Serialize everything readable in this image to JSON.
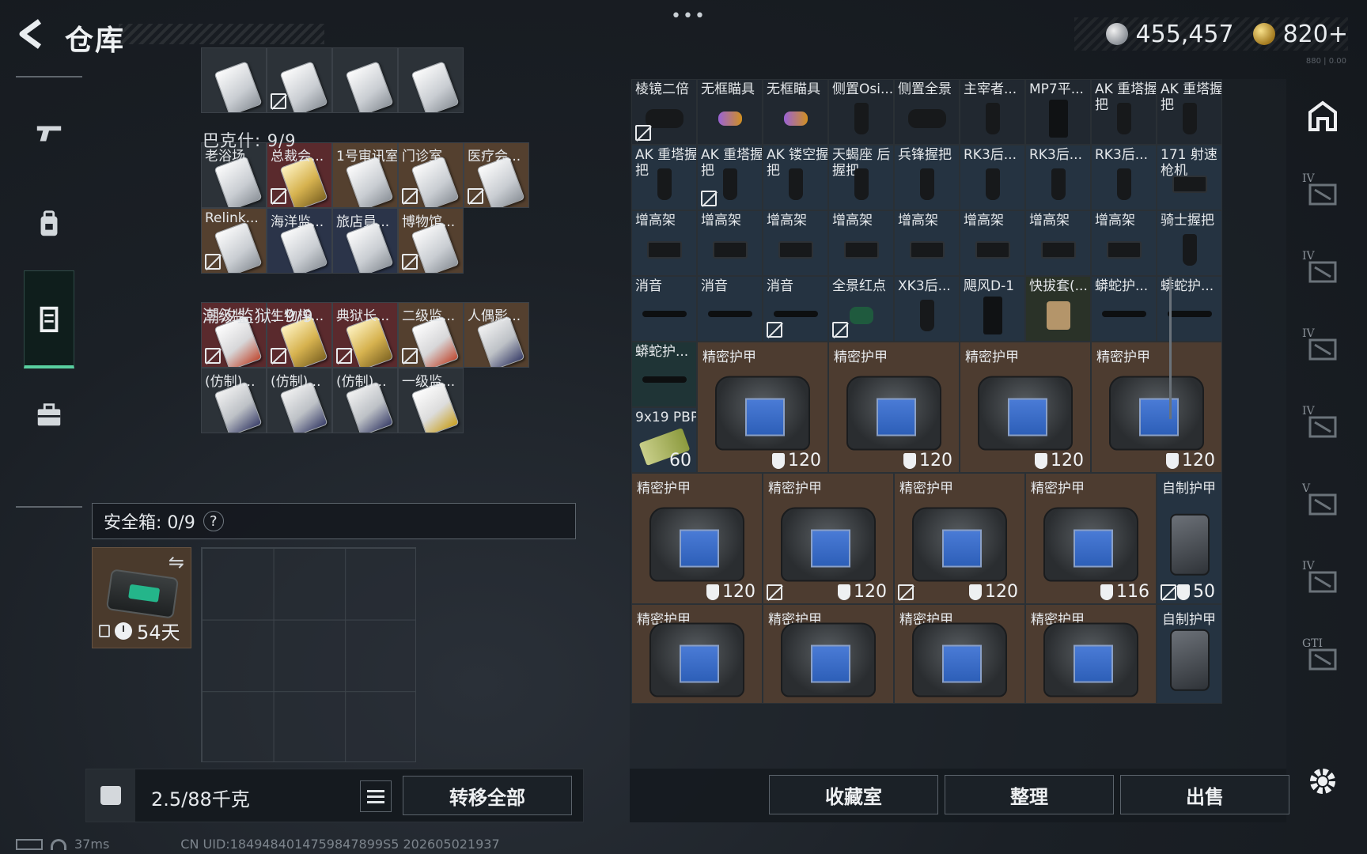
{
  "header": {
    "title": "仓库",
    "more": "•••",
    "currency_1": "455,457",
    "currency_2": "820+",
    "tiny_code": "880 | 0.00"
  },
  "left_nav": {
    "icons": [
      "pistol-icon",
      "backpack-icon",
      "locker-icon",
      "briefcase-icon"
    ]
  },
  "sections": {
    "bakeshi": "巴克什: 9/9",
    "chaoxi": "潮汐监狱: 9/9"
  },
  "keys_top": [
    {
      "color": "plain",
      "lock": false
    },
    {
      "color": "plain",
      "lock": true
    },
    {
      "color": "plain",
      "lock": false
    },
    {
      "color": "plain",
      "lock": false
    }
  ],
  "keys_bakeshi": [
    {
      "label": "老浴场",
      "color": "plain",
      "card": "",
      "lock": false
    },
    {
      "label": "总裁会...",
      "color": "red",
      "card": "gold",
      "lock": true
    },
    {
      "label": "1号审讯室",
      "color": "brown",
      "card": "",
      "lock": false
    },
    {
      "label": "门诊室",
      "color": "brown",
      "card": "",
      "lock": true
    },
    {
      "label": "医疗会...",
      "color": "brown",
      "card": "",
      "lock": true
    },
    {
      "label": "Relink...",
      "color": "brown",
      "card": "",
      "lock": true
    },
    {
      "label": "海洋监...",
      "color": "navy",
      "card": "",
      "lock": false
    },
    {
      "label": "旅店員...",
      "color": "navy",
      "card": "",
      "lock": false
    },
    {
      "label": "博物馆...",
      "color": "brown",
      "card": "",
      "lock": true
    }
  ],
  "keys_chaoxi": [
    {
      "label": "三级监...",
      "color": "red",
      "card": "red",
      "lock": true
    },
    {
      "label": "生物样...",
      "color": "red",
      "card": "gold",
      "lock": true
    },
    {
      "label": "典狱长...",
      "color": "red",
      "card": "gold",
      "lock": true
    },
    {
      "label": "二级监...",
      "color": "brown",
      "card": "red",
      "lock": true
    },
    {
      "label": "人偶影...",
      "color": "brown",
      "card": "dark",
      "lock": false
    },
    {
      "label": "(仿制)...",
      "color": "plain",
      "card": "dark",
      "lock": false
    },
    {
      "label": "(仿制)...",
      "color": "plain",
      "card": "dark",
      "lock": false
    },
    {
      "label": "(仿制)...",
      "color": "plain",
      "card": "dark",
      "lock": false
    },
    {
      "label": "一级监...",
      "color": "plain",
      "card": "yellow",
      "lock": false
    }
  ],
  "safe_box": {
    "title": "安全箱: 0/9",
    "help": "?",
    "duration": "54天",
    "swap": "⇋"
  },
  "inventory_footer": {
    "weight": "2.5/88千克",
    "transfer_all": "转移全部"
  },
  "status_bar": {
    "ping": "37ms",
    "uid": "CN UID:1849484014759847899S5 202605021937"
  },
  "right_grid": {
    "small_rows": [
      [
        {
          "label": "棱镜二倍",
          "color": "dim",
          "part": "scope",
          "lock": true
        },
        {
          "label": "无框瞄具",
          "color": "dim",
          "part": "purple",
          "lock": false
        },
        {
          "label": "无框瞄具",
          "color": "dim",
          "part": "purple",
          "lock": false
        },
        {
          "label": "侧置Osi...",
          "color": "dim",
          "part": "grip",
          "lock": false
        },
        {
          "label": "侧置全景",
          "color": "dim",
          "part": "scope",
          "lock": false
        },
        {
          "label": "主宰者...",
          "color": "dim",
          "part": "grip",
          "lock": false
        },
        {
          "label": "MP7平...",
          "color": "dim",
          "part": "mag",
          "lock": false
        },
        {
          "label": "AK 重塔握把",
          "color": "dim",
          "part": "grip",
          "lock": false
        },
        {
          "label": "AK 重塔握把",
          "color": "dim",
          "part": "grip",
          "lock": false
        }
      ],
      [
        {
          "label": "AK 重塔握把",
          "color": "blue",
          "part": "grip",
          "lock": false
        },
        {
          "label": "AK 重塔握把",
          "color": "blue",
          "part": "grip",
          "lock": true
        },
        {
          "label": "AK 镂空握把",
          "color": "blue",
          "part": "grip",
          "lock": false
        },
        {
          "label": "天蝎座 后握把",
          "color": "blue",
          "part": "grip",
          "lock": false
        },
        {
          "label": "兵锋握把",
          "color": "blue",
          "part": "grip",
          "lock": false
        },
        {
          "label": "RK3后...",
          "color": "blue",
          "part": "grip",
          "lock": false
        },
        {
          "label": "RK3后...",
          "color": "blue",
          "part": "grip",
          "lock": false
        },
        {
          "label": "RK3后...",
          "color": "blue",
          "part": "grip",
          "lock": false
        },
        {
          "label": "171 射速枪机",
          "color": "blue",
          "part": "rail",
          "lock": false
        }
      ],
      [
        {
          "label": "增高架",
          "color": "blue",
          "part": "rail",
          "lock": false
        },
        {
          "label": "增高架",
          "color": "blue",
          "part": "rail",
          "lock": false
        },
        {
          "label": "增高架",
          "color": "blue",
          "part": "rail",
          "lock": false
        },
        {
          "label": "增高架",
          "color": "blue",
          "part": "rail",
          "lock": false
        },
        {
          "label": "增高架",
          "color": "blue",
          "part": "rail",
          "lock": false
        },
        {
          "label": "增高架",
          "color": "blue",
          "part": "rail",
          "lock": false
        },
        {
          "label": "增高架",
          "color": "blue",
          "part": "rail",
          "lock": false
        },
        {
          "label": "增高架",
          "color": "blue",
          "part": "rail",
          "lock": false
        },
        {
          "label": "骑士握把",
          "color": "blue",
          "part": "grip",
          "lock": false
        }
      ],
      [
        {
          "label": "消音",
          "color": "blue",
          "part": "supp",
          "lock": false
        },
        {
          "label": "消音",
          "color": "blue",
          "part": "supp",
          "lock": false
        },
        {
          "label": "消音",
          "color": "blue",
          "part": "supp",
          "lock": true
        },
        {
          "label": "全景红点",
          "color": "blue",
          "part": "green",
          "lock": true
        },
        {
          "label": "XK3后...",
          "color": "blue",
          "part": "grip",
          "lock": false
        },
        {
          "label": "飓风D-1",
          "color": "blue",
          "part": "mag",
          "lock": false
        },
        {
          "label": "快拔套(...",
          "color": "olive",
          "part": "holster",
          "lock": false
        },
        {
          "label": "蟒蛇护...",
          "color": "blue",
          "part": "supp",
          "lock": false
        },
        {
          "label": "蟒蛇护...",
          "color": "blue",
          "part": "supp",
          "lock": false
        }
      ]
    ],
    "row5_extra": {
      "label": "蟒蛇护...",
      "color": "teal",
      "part": "supp"
    },
    "ammo": {
      "label": "9x19 PBP",
      "count": "60"
    },
    "armor_rows": [
      [
        {
          "label": "精密护甲",
          "dura": "120",
          "lock": false,
          "small": false
        },
        {
          "label": "精密护甲",
          "dura": "120",
          "lock": false,
          "small": false
        },
        {
          "label": "精密护甲",
          "dura": "120",
          "lock": false,
          "small": false
        },
        {
          "label": "精密护甲",
          "dura": "120",
          "lock": false,
          "small": false
        }
      ],
      [
        {
          "label": "精密护甲",
          "dura": "120",
          "lock": false,
          "small": false
        },
        {
          "label": "精密护甲",
          "dura": "120",
          "lock": true,
          "small": false
        },
        {
          "label": "精密护甲",
          "dura": "120",
          "lock": true,
          "small": false
        },
        {
          "label": "精密护甲",
          "dura": "116",
          "lock": false,
          "small": false
        },
        {
          "label": "自制护甲",
          "dura": "50",
          "lock": true,
          "small": true
        }
      ],
      [
        {
          "label": "精密护甲",
          "dura": "",
          "lock": false,
          "small": false
        },
        {
          "label": "精密护甲",
          "dura": "",
          "lock": false,
          "small": false
        },
        {
          "label": "精密护甲",
          "dura": "",
          "lock": false,
          "small": false
        },
        {
          "label": "精密护甲",
          "dura": "",
          "lock": false,
          "small": false
        },
        {
          "label": "自制护甲",
          "dura": "",
          "lock": false,
          "small": true
        }
      ]
    ]
  },
  "actions": {
    "collection": "收藏室",
    "organize": "整理",
    "sell": "出售"
  },
  "right_nav": {
    "levels": [
      "",
      "IV",
      "IV",
      "IV",
      "IV",
      "V",
      "IV",
      "GTI"
    ]
  },
  "colors": {
    "accent": "#59d0a0",
    "red_cell": "#5a2a2d",
    "brown_cell": "#54402f",
    "blue_cell": "#253341"
  }
}
